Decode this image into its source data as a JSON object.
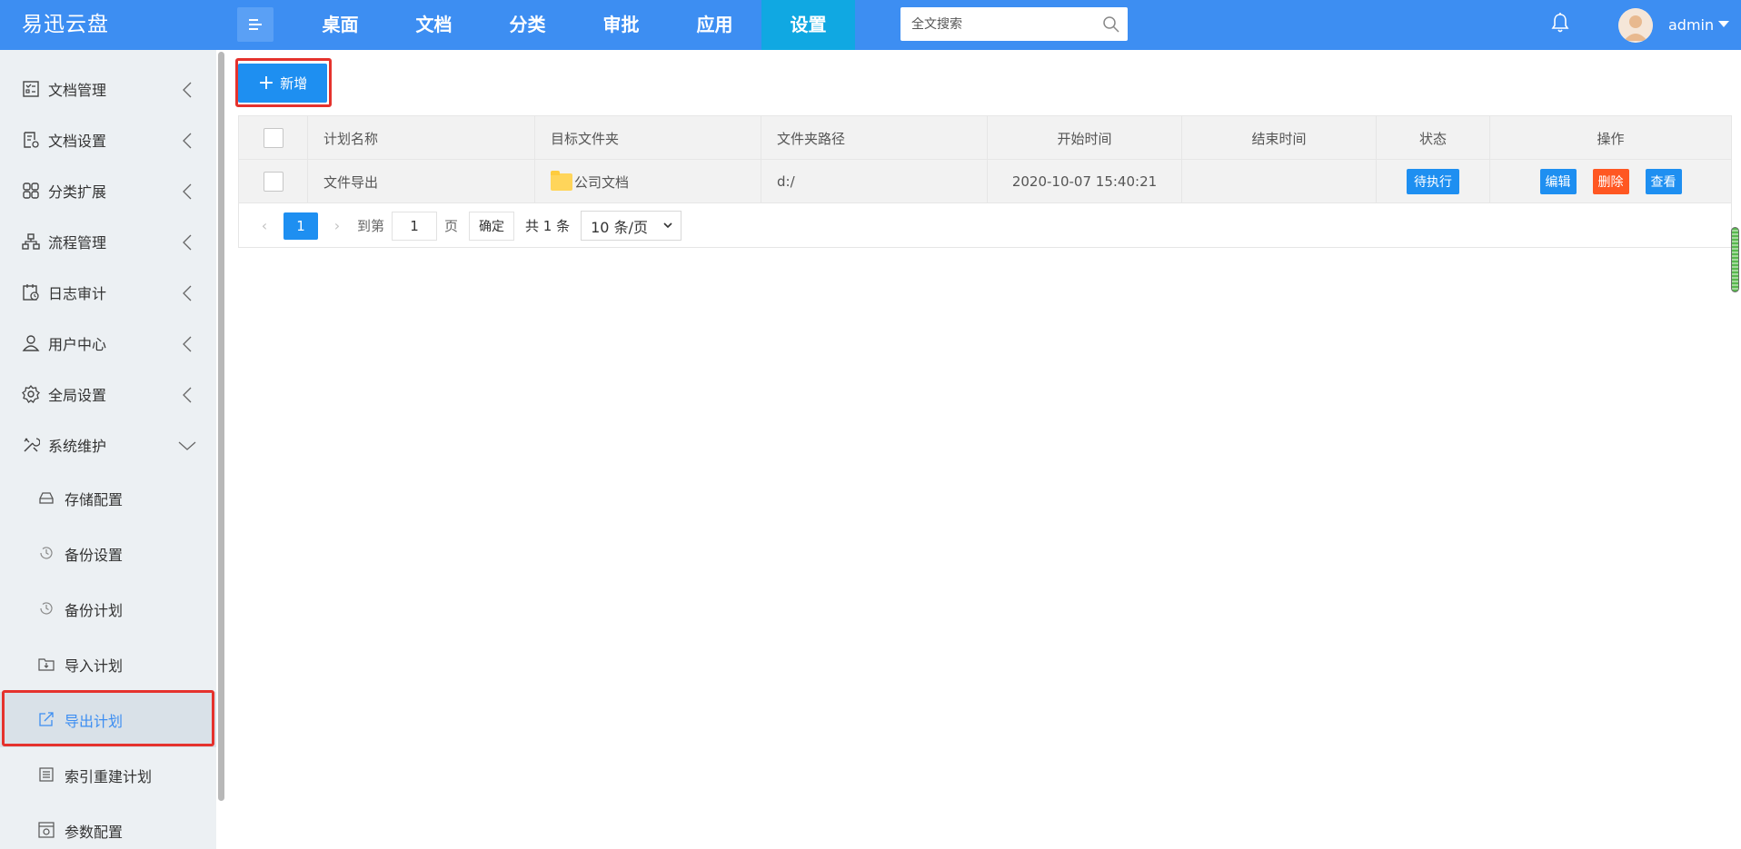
{
  "app": {
    "title": "易迅云盘"
  },
  "nav": {
    "items": [
      {
        "label": "桌面"
      },
      {
        "label": "文档"
      },
      {
        "label": "分类"
      },
      {
        "label": "审批"
      },
      {
        "label": "应用"
      },
      {
        "label": "设置",
        "active": true
      }
    ]
  },
  "search": {
    "placeholder": "全文搜索"
  },
  "user": {
    "name": "admin"
  },
  "sidebar": {
    "items": [
      {
        "label": "文档管理",
        "icon": "checklist-icon"
      },
      {
        "label": "文档设置",
        "icon": "doc-settings-icon"
      },
      {
        "label": "分类扩展",
        "icon": "grid-icon"
      },
      {
        "label": "流程管理",
        "icon": "flow-icon"
      },
      {
        "label": "日志审计",
        "icon": "calendar-clock-icon"
      },
      {
        "label": "用户中心",
        "icon": "user-icon"
      },
      {
        "label": "全局设置",
        "icon": "gear-icon"
      },
      {
        "label": "系统维护",
        "icon": "tools-icon",
        "expanded": true
      }
    ],
    "sub_items": [
      {
        "label": "存储配置",
        "icon": "storage-icon"
      },
      {
        "label": "备份设置",
        "icon": "history-icon"
      },
      {
        "label": "备份计划",
        "icon": "history-icon"
      },
      {
        "label": "导入计划",
        "icon": "import-icon"
      },
      {
        "label": "导出计划",
        "icon": "export-icon",
        "active": true
      },
      {
        "label": "索引重建计划",
        "icon": "list-icon"
      },
      {
        "label": "参数配置",
        "icon": "config-icon"
      }
    ]
  },
  "toolbar": {
    "add_label": "新增",
    "add_icon": "+"
  },
  "table": {
    "headers": [
      "计划名称",
      "目标文件夹",
      "文件夹路径",
      "开始时间",
      "结束时间",
      "状态",
      "操作"
    ],
    "rows": [
      {
        "name": "文件导出",
        "folder": "公司文档",
        "path": "d:/",
        "start": "2020-10-07 15:40:21",
        "end": "",
        "status": "待执行",
        "actions": {
          "edit": "编辑",
          "delete": "删除",
          "view": "查看"
        }
      }
    ]
  },
  "pager": {
    "current": "1",
    "goto_prefix": "到第",
    "goto_value": "1",
    "goto_suffix": "页",
    "confirm": "确定",
    "total": "共 1 条",
    "page_size": "10 条/页"
  },
  "colors": {
    "topbar": "#3d8ef2",
    "nav_active": "#10a8e2",
    "primary": "#1e8ff1",
    "danger": "#ff5722",
    "highlight": "#e5322d"
  }
}
